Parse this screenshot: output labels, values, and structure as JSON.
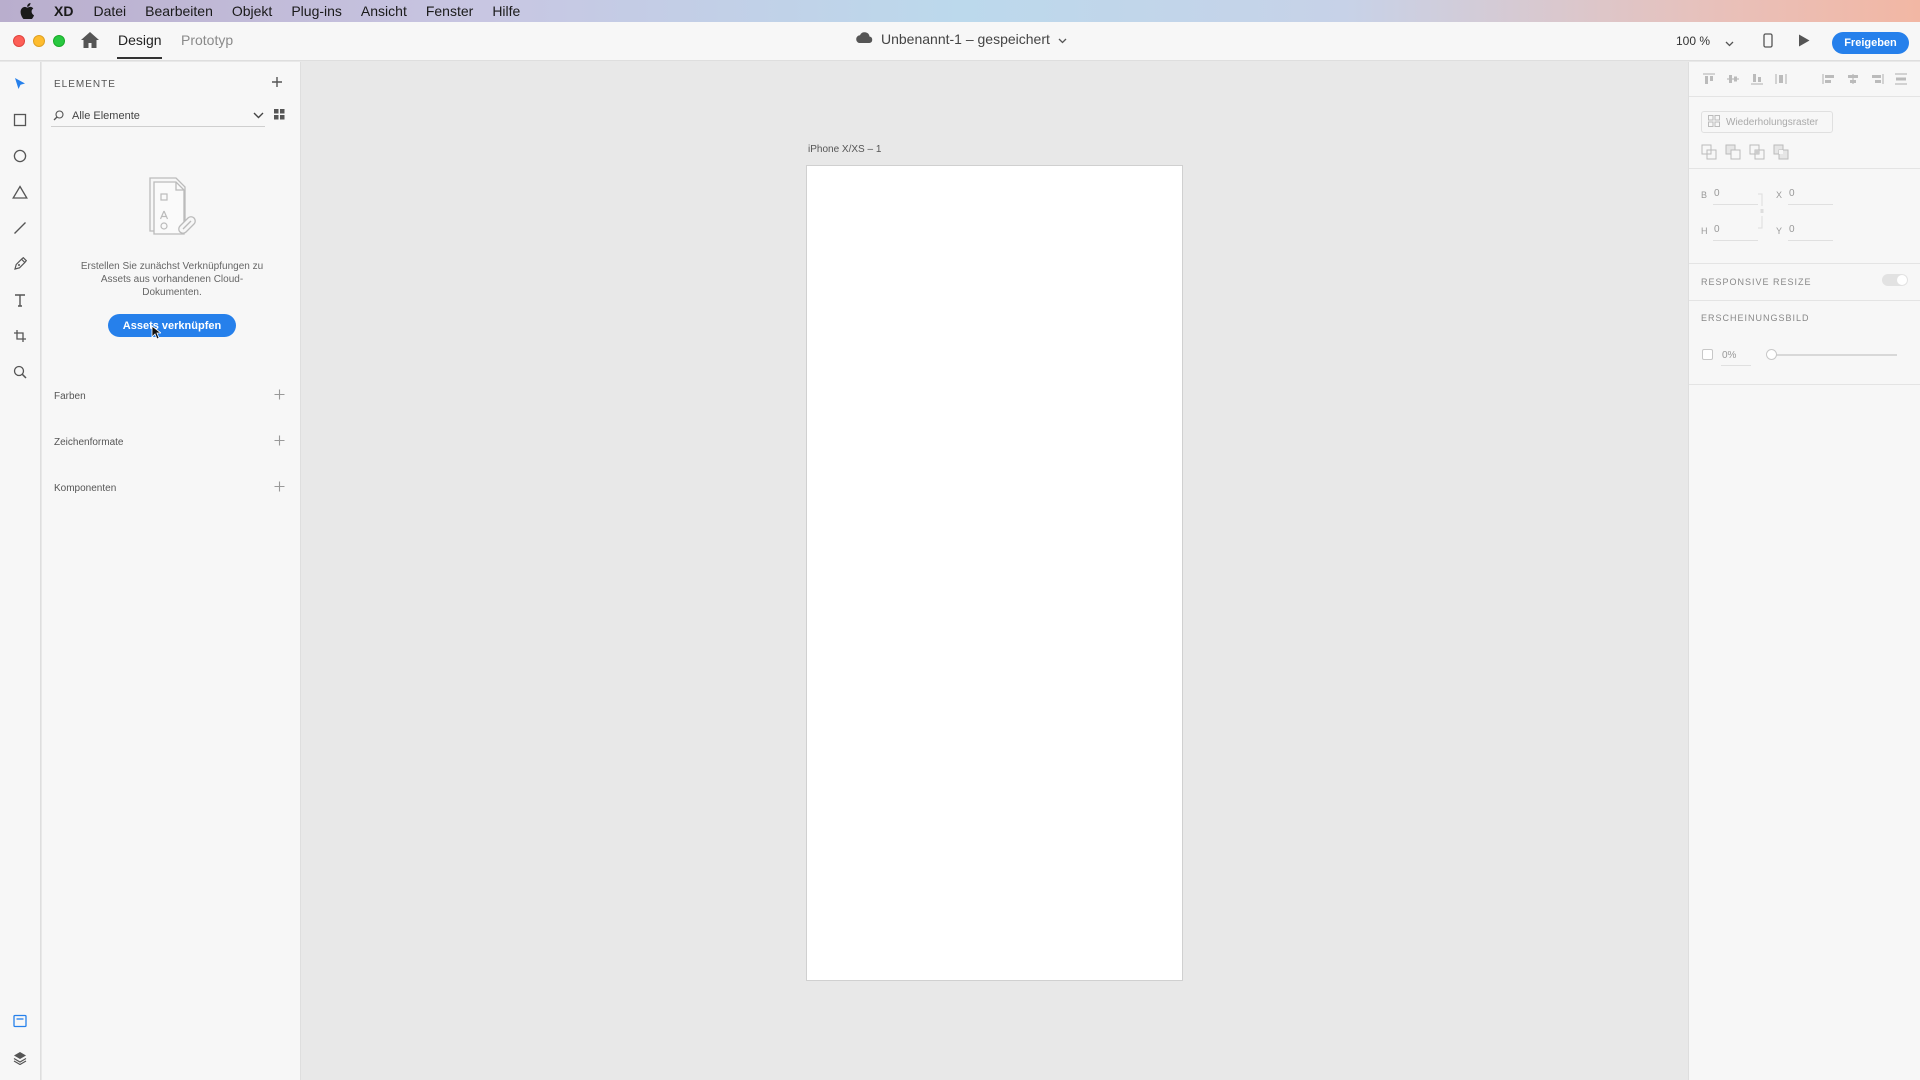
{
  "menubar": {
    "app": "XD",
    "items": [
      "Datei",
      "Bearbeiten",
      "Objekt",
      "Plug-ins",
      "Ansicht",
      "Fenster",
      "Hilfe"
    ]
  },
  "titlebar": {
    "tabs": {
      "design": "Design",
      "prototyp": "Prototyp"
    },
    "document": "Unbenannt-1 – gespeichert",
    "zoom": "100 %",
    "share": "Freigeben",
    "accent": "#2680eb"
  },
  "assets": {
    "heading": "ELEMENTE",
    "filter": "Alle Elemente",
    "empty_text": "Erstellen Sie zunächst Verknüpfungen zu Assets aus vorhandenen Cloud-Dokumenten.",
    "link_button": "Assets verknüpfen",
    "sections": [
      "Farben",
      "Zeichenformate",
      "Komponenten"
    ]
  },
  "canvas": {
    "artboard_label": "iPhone X/XS – 1"
  },
  "props": {
    "repeat_grid": "Wiederholungsraster",
    "w_label": "B",
    "w_value": "0",
    "x_label": "X",
    "x_value": "0",
    "h_label": "H",
    "h_value": "0",
    "y_label": "Y",
    "y_value": "0",
    "responsive": "RESPONSIVE RESIZE",
    "appearance": "ERSCHEINUNGSBILD",
    "opacity": "0%"
  }
}
